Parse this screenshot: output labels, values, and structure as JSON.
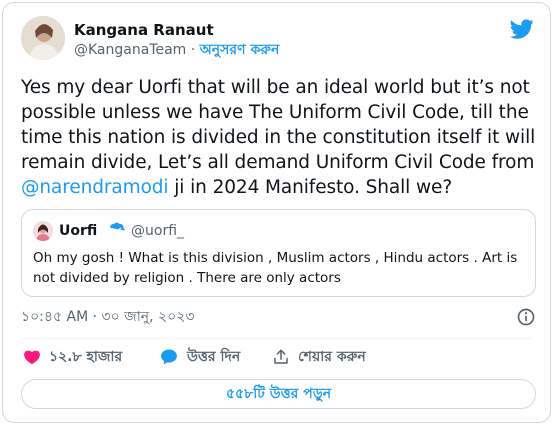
{
  "author": {
    "name": "Kangana Ranaut",
    "handle": "@KanganaTeam",
    "separator": "·",
    "follow_label": "অনুসরণ করুন"
  },
  "tweet": {
    "text_before_mention": "Yes my dear Uorfi that will be an ideal world but it’s not possible unless we have The Uniform Civil Code, till the time this nation is divided in the constitution itself it will remain divide, Let’s all demand Uniform Civil Code from ",
    "mention": "@narendramodi",
    "text_after_mention": " ji in 2024 Manifesto. Shall we?"
  },
  "quoted_tweet": {
    "name": "Uorfi",
    "handle": "@uorfi_",
    "text": "Oh my gosh ! What is this division , Muslim actors , Hindu actors . Art is not divided by religion . There are only actors"
  },
  "timestamp": "১০:৪৫ AM · ৩০ জানু, ২০২৩",
  "actions": {
    "like_count": "১২.৮ হাজার",
    "reply_label": "উত্তর দিন",
    "share_label": "শেয়ার করুন"
  },
  "read_replies_label": "৫৫৮টি উত্তর পড়ুন",
  "colors": {
    "accent": "#1d9bf0",
    "like": "#f91880",
    "text": "#0f1419",
    "muted": "#536471",
    "border": "#cfd9de"
  }
}
